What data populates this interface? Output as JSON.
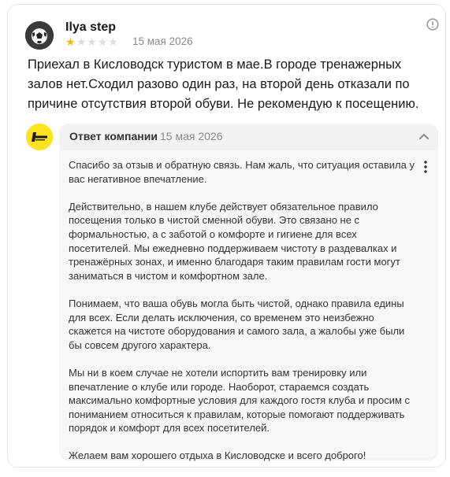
{
  "review": {
    "author": "Ilya step",
    "rating": 1,
    "max_rating": 5,
    "date": "15 мая 2026",
    "text": "Приехал в Кисловодск туристом в мае.В городе тренажерных залов нет.Сходил разово один раз, на второй день отказали по причине отсутствия второй обуви. Не рекомендую к посещению.",
    "info_icon": "info-icon"
  },
  "company_reply": {
    "logo_icon": "company-logo",
    "heading": "Ответ компании",
    "date": "15 мая 2026",
    "collapse_icon": "chevron-up-icon",
    "menu_icon": "more-vertical-icon",
    "paragraphs": [
      "Спасибо за отзыв и обратную связь. Нам жаль, что ситуация оставила у вас негативное впечатление.",
      "Действительно, в нашем клубе действует обязательное правило посещения только в чистой сменной обуви. Это связано не с формальностью, а с заботой о комфорте и гигиене для всех посетителей. Мы ежедневно поддерживаем чистоту в раздевалках и тренажёрных зонах, и именно благодаря таким правилам гости могут заниматься в чистом и комфортном зале.",
      "Понимаем, что ваша обувь могла быть чистой, однако правила едины для всех. Если делать исключения, со временем это неизбежно скажется на чистоте оборудования и самого зала, а жалобы уже были бы совсем другого характера.",
      "Мы ни в коем случае не хотели испортить вам тренировку или впечатление о клубе или городе. Наоборот, стараемся создать максимально комфортные условия для каждого гостя клуба и просим с пониманием относиться к правилам, которые помогают поддерживать порядок и комфорт для всех посетителей.",
      "Желаем вам хорошего отдыха в Кисловодске и всего доброго!"
    ]
  },
  "colors": {
    "star_on": "#f6b800",
    "star_off": "#dcdcdc",
    "logo_bg": "#ffe31f"
  }
}
